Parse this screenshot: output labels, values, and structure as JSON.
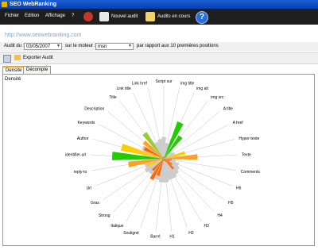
{
  "window": {
    "title": "SEO WebRanking"
  },
  "menu": {
    "fichier": "Fichier",
    "edition": "Edition",
    "affichage": "Affichage",
    "help": "?"
  },
  "toolbar": {
    "new_audit": "Nouvel audit",
    "audits_in_progress": "Audits en cours"
  },
  "site": {
    "url": "http://www.seowebranking.com"
  },
  "audit": {
    "date_label": "Audit du :",
    "date_value": "03/05/2007",
    "engine_label": "sur le moteur :",
    "engine_value": "msn",
    "positions_label": "par rapport aux 10 premières positions"
  },
  "actions": {
    "export": "Exporter Audit"
  },
  "tabs": [
    {
      "label": "Densité",
      "active": true
    },
    {
      "label": "Décompte",
      "active": false
    }
  ],
  "panel": {
    "title": "Densité"
  },
  "colors": {
    "green": "#22cc00",
    "lightgreen": "#99cc33",
    "orange": "#ff6600",
    "lightorange": "#ffa020",
    "yellow": "#ffcc00",
    "gray": "#cccccc"
  },
  "chart_data": {
    "type": "polar_bar",
    "categories": [
      "Script sur",
      "img title",
      "img alt",
      "img src",
      "A title",
      "A href",
      "Hyper-texte",
      "Texte",
      "Comments",
      "H6",
      "H5",
      "H4",
      "H3",
      "H2",
      "H1",
      "Barré",
      "Souligné",
      "Italique",
      "Strong",
      "Gras",
      "Url",
      "reply-to",
      "identifier-url",
      "Author",
      "Keywords",
      "Description",
      "Title",
      "Link title",
      "Link href"
    ],
    "reference": [
      0.55,
      0.4,
      0.55,
      0.3,
      0.25,
      0.3,
      0.35,
      0.4,
      0.3,
      0.4,
      0.45,
      0.5,
      0.55,
      0.55,
      0.6,
      0.6,
      0.55,
      0.55,
      0.5,
      0.55,
      0.5,
      0.55,
      0.5,
      0.55,
      0.6,
      0.45,
      0.5,
      0.45,
      0.5
    ],
    "values": [
      0.05,
      0.05,
      1.0,
      0.7,
      0.1,
      0.1,
      0.55,
      0.85,
      0.2,
      0.15,
      0.25,
      0.35,
      0.1,
      0.05,
      0.05,
      0.05,
      0.45,
      0.6,
      0.4,
      0.05,
      0.45,
      0.9,
      1.3,
      1.1,
      0.55,
      0.65,
      0.8,
      0.05,
      0.05
    ],
    "value_colors": [
      "#994400",
      "#cccccc",
      "#22cc00",
      "#22cc00",
      "#ff6600",
      "#ffa020",
      "#ffcc00",
      "#ffa020",
      "#ff6600",
      "#ff6600",
      "#ff6600",
      "#ff6600",
      "#ff6600",
      "#994400",
      "#994400",
      "#994400",
      "#ff6600",
      "#ff6600",
      "#ff6600",
      "#994400",
      "#ffcc00",
      "#ffa020",
      "#22cc00",
      "#ffcc00",
      "#ff6600",
      "#ffa020",
      "#99cc33",
      "#994400",
      "#994400"
    ]
  }
}
